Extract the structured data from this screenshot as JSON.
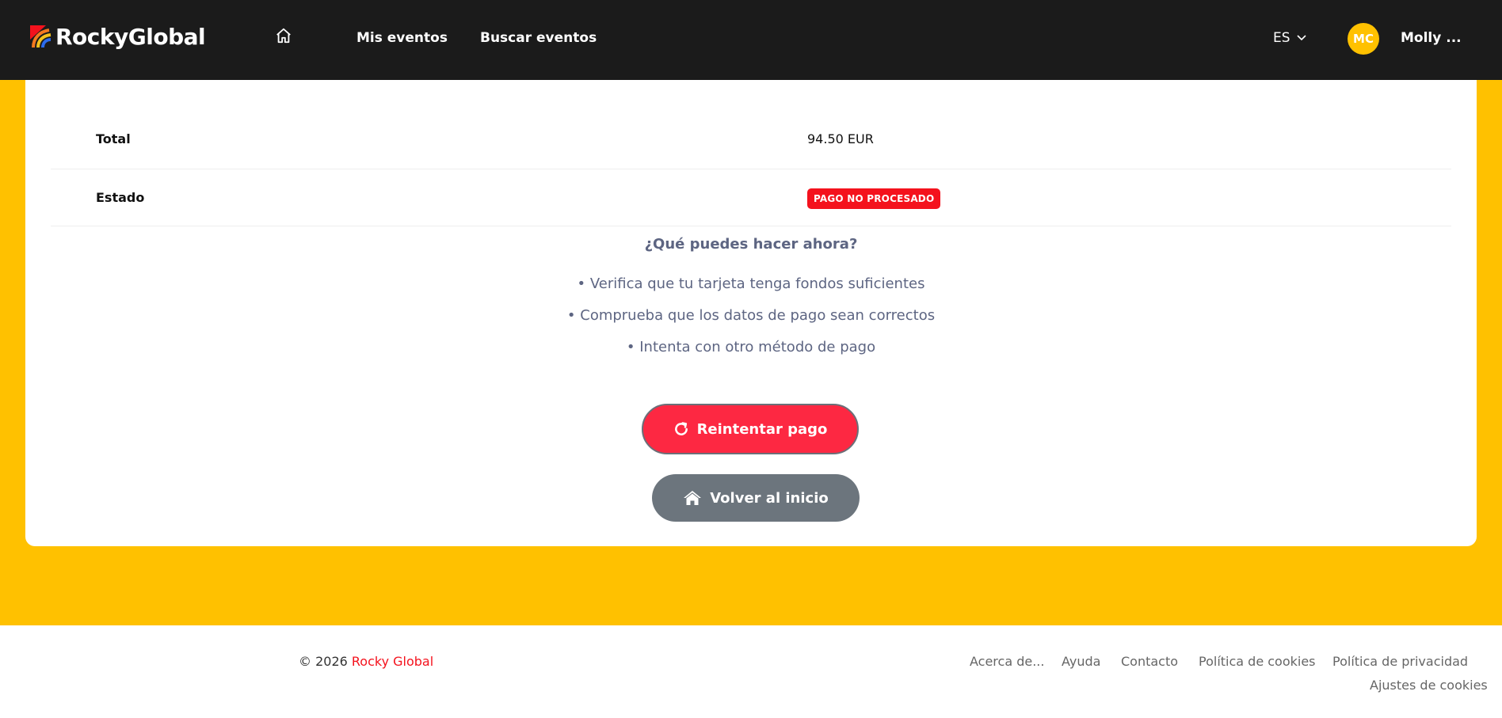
{
  "header": {
    "brand": "RockyGlobal",
    "nav": {
      "mis_eventos": "Mis eventos",
      "buscar_eventos": "Buscar eventos"
    },
    "language": "ES",
    "avatar_initials": "MC",
    "username": "Molly ..."
  },
  "order": {
    "total_label": "Total",
    "total_value": "94.50 EUR",
    "status_label": "Estado",
    "status_badge": "PAGO NO PROCESADO"
  },
  "help": {
    "title": "¿Qué puedes hacer ahora?",
    "items": [
      "• Verifica que tu tarjeta tenga fondos suficientes",
      "• Comprueba que los datos de pago sean correctos",
      "• Intenta con otro método de pago"
    ]
  },
  "actions": {
    "retry_label": "Reintentar pago",
    "home_label": "Volver al inicio"
  },
  "footer": {
    "copyright_prefix": "© 2026 ",
    "copyright_brand": "Rocky Global",
    "links": {
      "about": "Acerca de...",
      "help": "Ayuda",
      "contact": "Contacto",
      "cookies": "Política de cookies",
      "privacy": "Política de privacidad",
      "cookie_settings": "Ajustes de cookies"
    }
  },
  "colors": {
    "topbar": "#1b1b1b",
    "background": "#ffc100",
    "accent_red": "#fd2842",
    "badge_red": "#f4121d",
    "secondary_gray": "#6c757d",
    "muted_text": "#5d6582"
  }
}
